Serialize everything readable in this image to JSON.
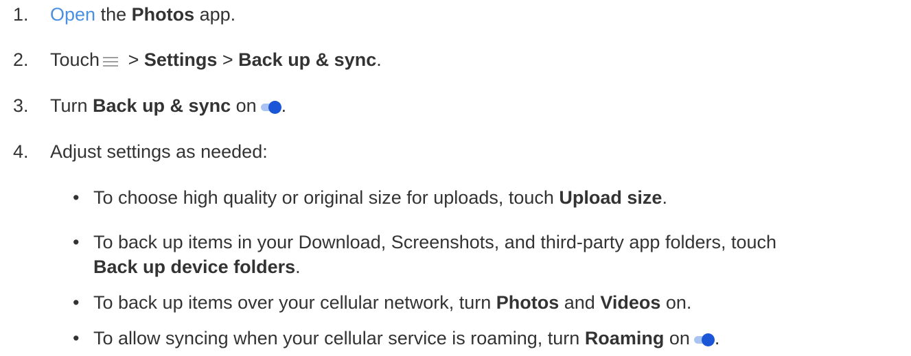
{
  "steps": [
    {
      "number": "1.",
      "link": "Open",
      "t1": " the ",
      "b1": "Photos",
      "t2": " app."
    },
    {
      "number": "2.",
      "t1": "Touch",
      "t2": " > ",
      "b1": "Settings",
      "t3": " > ",
      "b2": "Back up & sync",
      "t4": "."
    },
    {
      "number": "3.",
      "t1": "Turn ",
      "b1": "Back up & sync",
      "t2": " on",
      "t3": "."
    },
    {
      "number": "4.",
      "t1": "Adjust settings as needed:"
    }
  ],
  "bullets": [
    {
      "dot": "•",
      "t1": "To choose high quality or original size for uploads, touch ",
      "b1": "Upload size",
      "t2": "."
    },
    {
      "dot": "•",
      "t1": "To back up items in your Download, Screenshots, and third-party app folders, touch",
      "b1": "Back up device folders",
      "t2": "."
    },
    {
      "dot": "•",
      "t1": "To back up items over your cellular network, turn ",
      "b1": "Photos",
      "t2": " and ",
      "b2": "Videos",
      "t3": " on."
    },
    {
      "dot": "•",
      "t1": "To allow syncing when your cellular service is roaming, turn ",
      "b1": "Roaming",
      "t2": " on",
      "t3": "."
    }
  ],
  "icons": {
    "menu": "menu-icon",
    "toggle": "toggle-on-icon",
    "toggle_colors": {
      "track": "#a9c4f3",
      "knob": "#1a56d6"
    },
    "link_color": "#4a90e2"
  }
}
